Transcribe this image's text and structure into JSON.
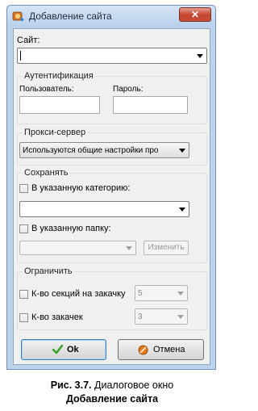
{
  "window": {
    "title": "Добавление сайта",
    "close_glyph": "✕"
  },
  "site": {
    "label": "Сайт:",
    "value": ""
  },
  "auth": {
    "group_title": "Аутентификация",
    "user_label": "Пользователь:",
    "user_value": "",
    "password_label": "Пароль:",
    "password_value": ""
  },
  "proxy": {
    "group_title": "Прокси-сервер",
    "selected": "Используются общие настройки про"
  },
  "save": {
    "group_title": "Сохранять",
    "category_label": "В указанную категорию:",
    "category_checked": false,
    "category_value": "",
    "folder_label": "В указанную папку:",
    "folder_checked": false,
    "folder_value": "",
    "change_button": "Изменить"
  },
  "limit": {
    "group_title": "Ограничить",
    "sections_label": "К-во секций на закачку",
    "sections_checked": false,
    "sections_value": "5",
    "downloads_label": "К-во закачек",
    "downloads_checked": false,
    "downloads_value": "3"
  },
  "buttons": {
    "ok": "Ok",
    "cancel": "Отмена"
  },
  "figure_caption": {
    "prefix": "Рис. 3.7.",
    "text": "Диалоговое окно",
    "title_bold": "Добавление сайта"
  },
  "icons": {
    "app": "flashget-icon",
    "ok": "checkmark-icon",
    "cancel": "cancel-circle-icon",
    "close": "close-icon"
  },
  "colors": {
    "title_bar": "#bcd3ec",
    "close_button": "#c4442f",
    "ok_check": "#3aa12b",
    "cancel_circle": "#e67a1c"
  }
}
